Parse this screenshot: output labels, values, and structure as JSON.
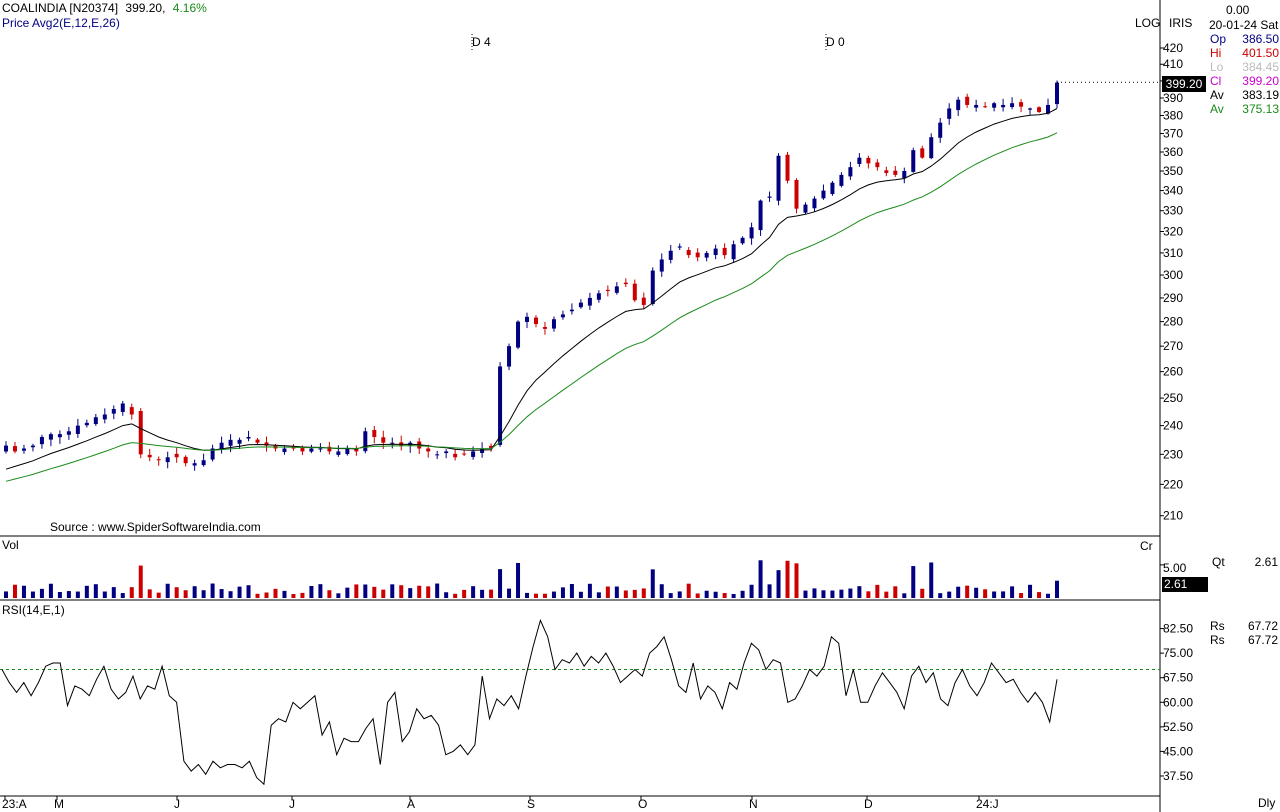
{
  "header": {
    "symbol": "COALINDIA [N20374]",
    "price": "399.20,",
    "change_pct": "4.16%",
    "indicator_line": "Price  Avg2(E,12,E,26)",
    "marker_d4": "D 4",
    "marker_d0": "D 0",
    "source": "Source : www.SpiderSoftwareIndia.com",
    "log_label": "LOG",
    "iris_label": "IRIS",
    "top_value": "0.00",
    "date": "20-01-24 Sat"
  },
  "ohlc": [
    {
      "label": "Op",
      "value": "386.50",
      "color": "#000080"
    },
    {
      "label": "Hi",
      "value": "401.50",
      "color": "#cc0000"
    },
    {
      "label": "Lo",
      "value": "384.45",
      "color": "#bbbbbb"
    },
    {
      "label": "Cl",
      "value": "399.20",
      "color": "#cc00cc"
    },
    {
      "label": "Av",
      "value": "383.19",
      "color": "#000000"
    },
    {
      "label": "Av",
      "value": "375.13",
      "color": "#1a8a1a"
    }
  ],
  "price_tag": "399.20",
  "volume_panel": {
    "label": "Vol",
    "unit": "Cr",
    "axis_tick": "5.00",
    "tag": "2.61",
    "qt_label": "Qt",
    "qt_value": "2.61"
  },
  "rsi_panel": {
    "label": "RSI(14,E,1)",
    "rs": [
      {
        "label": "Rs",
        "value": "67.72"
      },
      {
        "label": "Rs",
        "value": "67.72"
      }
    ]
  },
  "footer": {
    "period": "Dly"
  },
  "colors": {
    "up": "#000080",
    "down": "#cc0000",
    "ema12": "#000000",
    "ema26": "#1a8a1a",
    "rsi_ref": "#1a8a1a"
  },
  "chart_data": [
    {
      "type": "candlestick",
      "scale": "log",
      "ylim": [
        205,
        425
      ],
      "ytick_labels": [
        "210",
        "220",
        "230",
        "240",
        "250",
        "260",
        "270",
        "280",
        "290",
        "300",
        "310",
        "320",
        "330",
        "340",
        "350",
        "360",
        "370",
        "380",
        "390",
        "400",
        "410",
        "420"
      ],
      "xtick_labels": [
        "23:A",
        "M",
        "J",
        "J",
        "A",
        "S",
        "O",
        "N",
        "D",
        "24:J"
      ],
      "note_close_series_approx": [
        233,
        231,
        232,
        233,
        236,
        237,
        237,
        238,
        240,
        241,
        243,
        244,
        246,
        248,
        244,
        230,
        229,
        228,
        229,
        229,
        227,
        227,
        228,
        232,
        234,
        235,
        235,
        236,
        234,
        233,
        232,
        232,
        232,
        231,
        232,
        232,
        231,
        231,
        232,
        231,
        238,
        236,
        234,
        234,
        233,
        234,
        232,
        231,
        230,
        231,
        229,
        230,
        231,
        232,
        232,
        262,
        270,
        280,
        282,
        279,
        277,
        281,
        283,
        285,
        288,
        290,
        292,
        293,
        295,
        296,
        289,
        287,
        302,
        307,
        311,
        313,
        309,
        308,
        310,
        312,
        309,
        314,
        317,
        322,
        335,
        337,
        358,
        345,
        331,
        333,
        336,
        340,
        344,
        348,
        352,
        357,
        354,
        352,
        349,
        348,
        350,
        361,
        357,
        368,
        376,
        384,
        389,
        386,
        386,
        385,
        387,
        386,
        387,
        385,
        384,
        382,
        386,
        399
      ],
      "ema12_series": [],
      "ema26_series": []
    },
    {
      "type": "bar",
      "title": "Vol",
      "ylim": [
        0,
        8
      ],
      "values": [],
      "note": "volume bars derived per candle"
    },
    {
      "type": "line",
      "title": "RSI(14,E,1)",
      "ylim": [
        32,
        90
      ],
      "ytick_labels": [
        "37.50",
        "45.00",
        "52.50",
        "60.00",
        "67.50",
        "75.00",
        "82.50"
      ],
      "reference_line": 70,
      "values": [
        70,
        66,
        63,
        66,
        62,
        66,
        71,
        72,
        72,
        59,
        65,
        64,
        62,
        67,
        71,
        64,
        61,
        63,
        68,
        61,
        65,
        64,
        71,
        62,
        60,
        42,
        39,
        41,
        38,
        42,
        40,
        41,
        41,
        40,
        42,
        37,
        35,
        53,
        55,
        54,
        60,
        58,
        60,
        62,
        50,
        54,
        44,
        49,
        48,
        48,
        52,
        55,
        41,
        60,
        63,
        48,
        51,
        58,
        55,
        56,
        53,
        44,
        45,
        47,
        44,
        47,
        68,
        55,
        61,
        59,
        62,
        58,
        68,
        77,
        85,
        80,
        70,
        73,
        72,
        75,
        71,
        74,
        72,
        75,
        71,
        66,
        68,
        70,
        68,
        75,
        77,
        80,
        73,
        65,
        63,
        72,
        61,
        65,
        63,
        58,
        66,
        64,
        72,
        78,
        76,
        70,
        73,
        72,
        60,
        61,
        65,
        70,
        68,
        71,
        80,
        78,
        62,
        70,
        60,
        60,
        65,
        69,
        66,
        63,
        58,
        68,
        71,
        66,
        69,
        61,
        59,
        66,
        70,
        65,
        62,
        66,
        72,
        69,
        66,
        67,
        63,
        60,
        63,
        60,
        54,
        67
      ]
    }
  ]
}
